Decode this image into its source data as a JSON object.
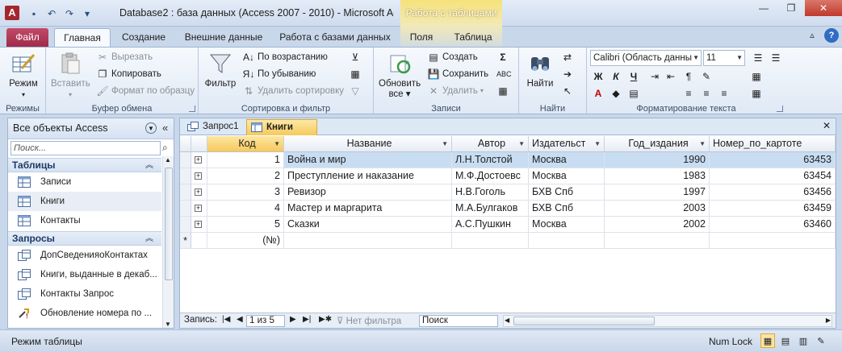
{
  "window": {
    "title": "Database2 : база данных (Access 2007 - 2010) - Microsoft Ac...",
    "context_tab_group": "Работа с таблицами",
    "app_icon_letter": "A"
  },
  "ribbon_tabs": [
    {
      "label": "Файл"
    },
    {
      "label": "Главная"
    },
    {
      "label": "Создание"
    },
    {
      "label": "Внешние данные"
    },
    {
      "label": "Работа с базами данных"
    },
    {
      "label": "Поля"
    },
    {
      "label": "Таблица"
    }
  ],
  "ribbon": {
    "views": {
      "mode_label": "Режим",
      "group_label": "Режимы"
    },
    "clipboard": {
      "paste": "Вставить",
      "cut": "Вырезать",
      "copy": "Копировать",
      "format_painter": "Формат по образцу",
      "group_label": "Буфер обмена"
    },
    "sort_filter": {
      "filter": "Фильтр",
      "ascending": "По возрастанию",
      "descending": "По убыванию",
      "remove_sort": "Удалить сортировку",
      "group_label": "Сортировка и фильтр"
    },
    "records": {
      "refresh_all": "Обновить",
      "refresh_all_2": "все",
      "new": "Создать",
      "save": "Сохранить",
      "delete": "Удалить",
      "totals": "Σ",
      "group_label": "Записи"
    },
    "find": {
      "find": "Найти",
      "group_label": "Найти"
    },
    "text_format": {
      "font": "Calibri (Область данны",
      "size": "11",
      "group_label": "Форматирование текста"
    }
  },
  "nav_pane": {
    "title": "Все объекты Access",
    "search_placeholder": "Поиск...",
    "sections": [
      {
        "title": "Таблицы",
        "items": [
          "Записи",
          "Книги",
          "Контакты"
        ]
      },
      {
        "title": "Запросы",
        "items": [
          "ДопСведенияоКонтактах",
          "Книги, выданные в декаб...",
          "Контакты Запрос",
          "Обновление номера по ..."
        ]
      }
    ]
  },
  "doc_tabs": [
    {
      "label": "Запрос1"
    },
    {
      "label": "Книги"
    }
  ],
  "table": {
    "columns": [
      "Код",
      "Название",
      "Автор",
      "Издательст",
      "Год_издания",
      "Номер_по_картоте"
    ],
    "rows": [
      [
        "1",
        "Война и мир",
        "Л.Н.Толстой",
        "Москва",
        "1990",
        "63453"
      ],
      [
        "2",
        "Преступление и наказание",
        "М.Ф.Достоевс",
        "Москва",
        "1983",
        "63454"
      ],
      [
        "3",
        "Ревизор",
        "Н.В.Гоголь",
        "БХВ Спб",
        "1997",
        "63456"
      ],
      [
        "4",
        "Мастер и маргарита",
        "М.А.Булгаков",
        "БХВ Спб",
        "2003",
        "63459"
      ],
      [
        "5",
        "Сказки",
        "А.С.Пушкин",
        "Москва",
        "2002",
        "63460"
      ]
    ],
    "new_row_label": "(№)"
  },
  "record_nav": {
    "label": "Запись:",
    "position": "1 из 5",
    "filter_state": "Нет фильтра",
    "search": "Поиск"
  },
  "status": {
    "mode": "Режим таблицы",
    "num_lock": "Num Lock"
  },
  "colors": {
    "accent": "#2b579a",
    "file_tab": "#a12a4a",
    "selection": "#c8ddf2",
    "active_header": "#f6c95b"
  }
}
